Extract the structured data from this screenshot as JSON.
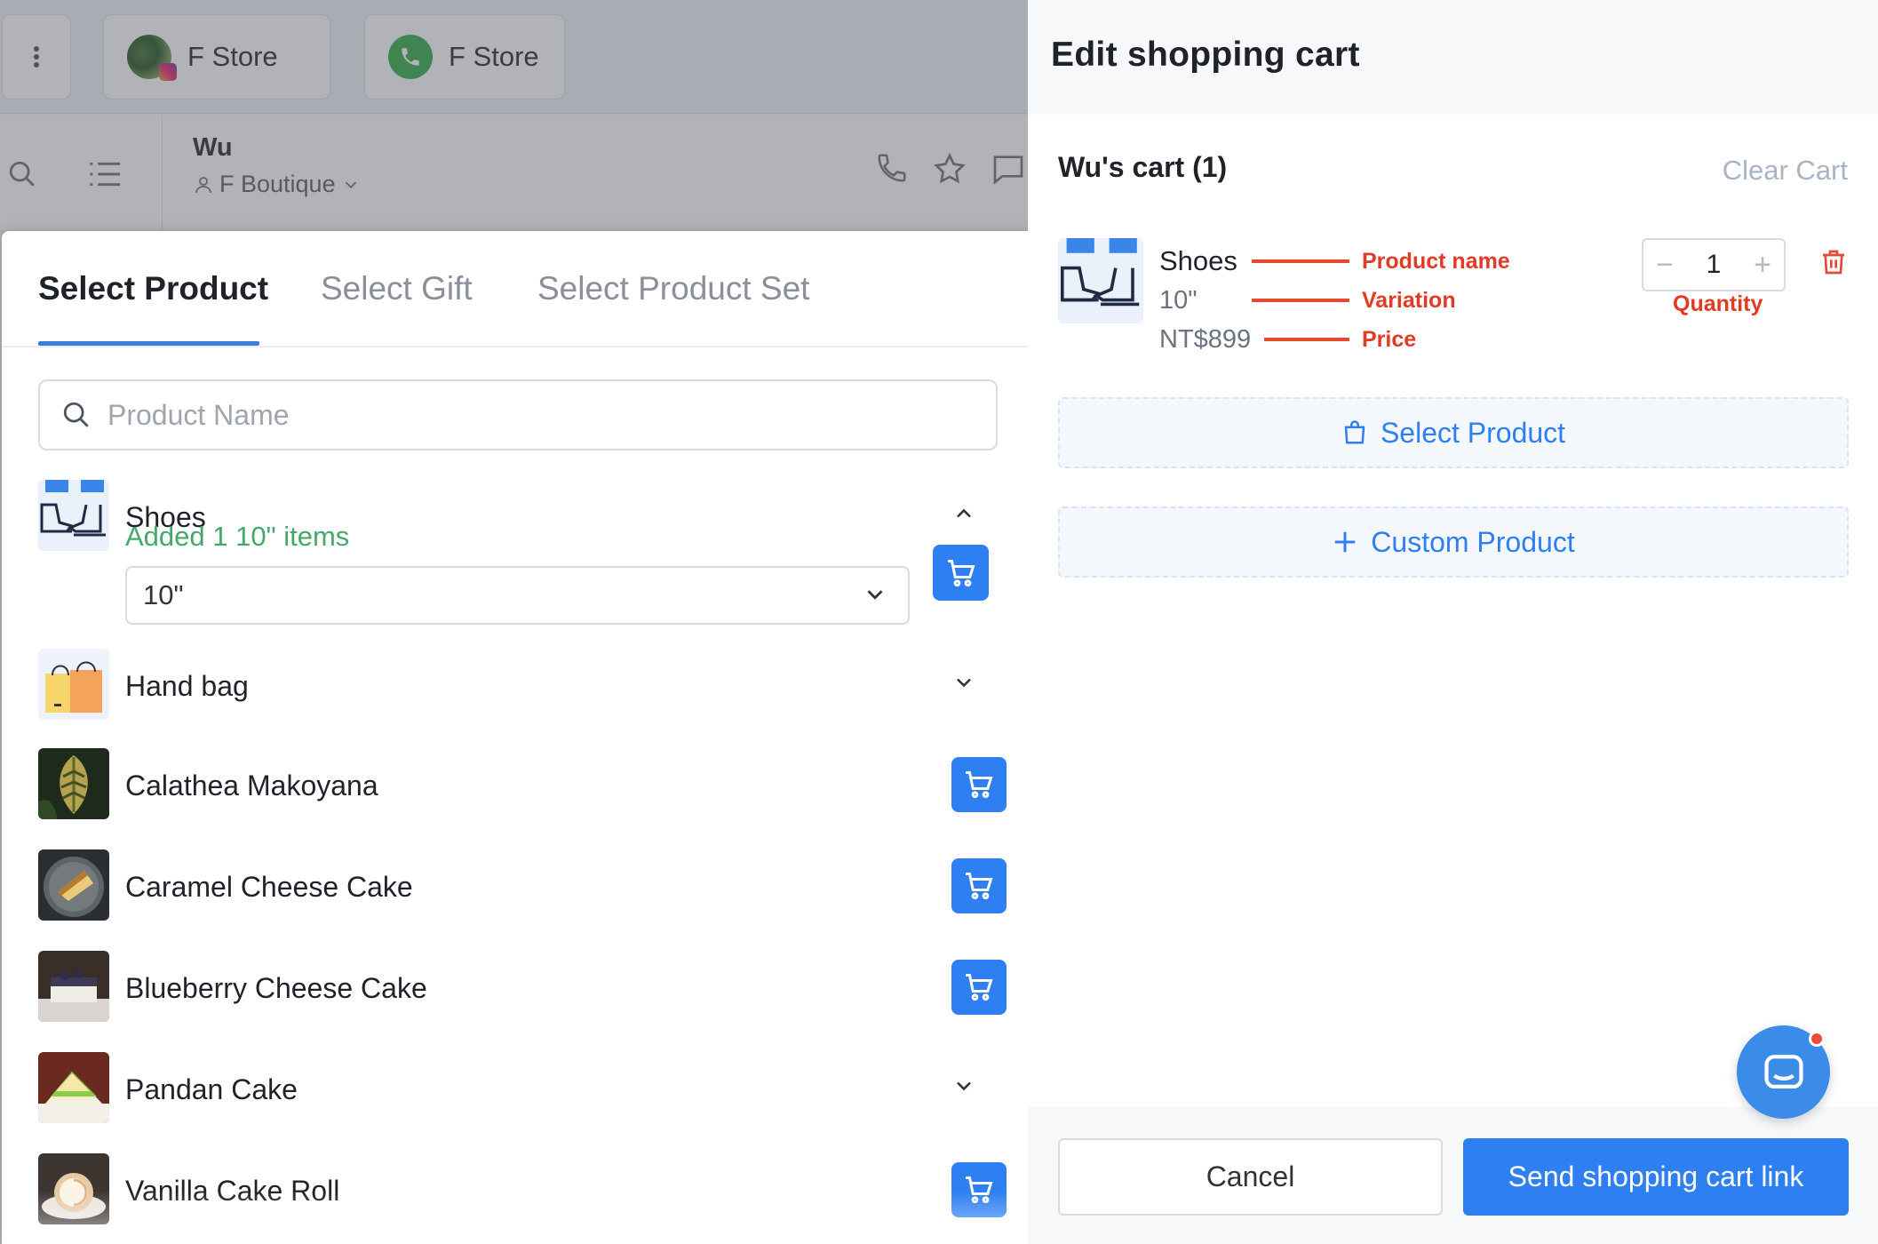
{
  "background": {
    "store_tabs": [
      {
        "label": "F Store",
        "icon": "social-channels-icon"
      },
      {
        "label": "F Store",
        "icon": "whatsapp-phone-icon"
      }
    ],
    "conversation": {
      "name": "Wu",
      "assignee": "F Boutique"
    }
  },
  "picker": {
    "tabs": [
      {
        "label": "Select Product",
        "active": true
      },
      {
        "label": "Select Gift",
        "active": false
      },
      {
        "label": "Select Product Set",
        "active": false
      }
    ],
    "search_placeholder": "Product Name",
    "products": [
      {
        "name": "Shoes",
        "expanded": true,
        "added_note": "Added 1 10\" items",
        "selected_variant": "10\""
      },
      {
        "name": "Hand bag",
        "control": "expand"
      },
      {
        "name": "Calathea Makoyana",
        "control": "cart"
      },
      {
        "name": "Caramel Cheese Cake",
        "control": "cart"
      },
      {
        "name": "Blueberry Cheese Cake",
        "control": "cart"
      },
      {
        "name": "Pandan Cake",
        "control": "expand"
      },
      {
        "name": "Vanilla Cake Roll",
        "control": "cart"
      }
    ]
  },
  "drawer": {
    "title": "Edit shopping cart",
    "cart_title": "Wu's cart (1)",
    "clear_cart": "Clear Cart",
    "item": {
      "name": "Shoes",
      "variation": "10\"",
      "price": "NT$899",
      "quantity": "1"
    },
    "annotations": {
      "product_name": "Product name",
      "variation": "Variation",
      "price": "Price",
      "quantity": "Quantity"
    },
    "select_product": "Select Product",
    "custom_product": "Custom Product",
    "cancel": "Cancel",
    "send": "Send shopping cart link"
  },
  "colors": {
    "accent": "#2d7ff2",
    "success": "#45a86b",
    "annotation": "#e23b24",
    "danger": "#e5483a"
  }
}
